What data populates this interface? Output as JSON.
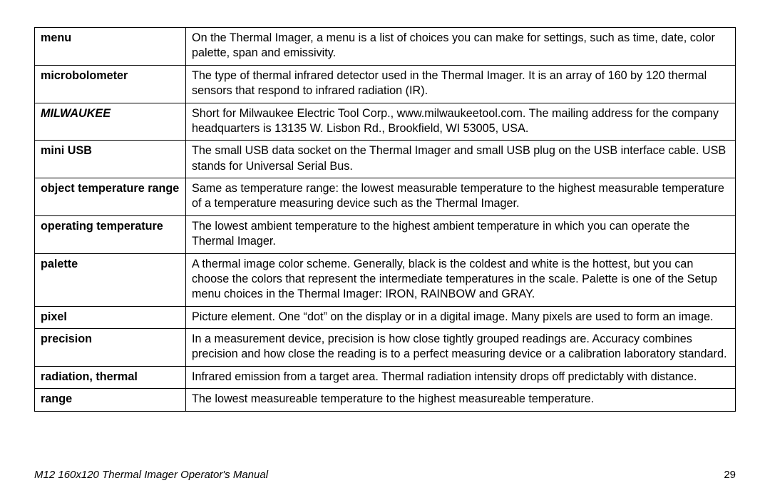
{
  "glossary": [
    {
      "term": "menu",
      "termClass": "",
      "def": "On the Thermal Imager, a menu is a list of choices you can make for settings, such as time, date, color palette, span and emissivity."
    },
    {
      "term": "microbolometer",
      "termClass": "",
      "def": "The type of thermal infrared detector used in the Thermal Imager. It is an array of 160 by 120 thermal sensors that respond to infrared radiation (IR)."
    },
    {
      "term": "MILWAUKEE",
      "termClass": "italic",
      "def": "Short for Milwaukee Electric Tool Corp., www.milwaukeetool.com. The mailing address for the company headquarters is 13135 W. Lisbon Rd., Brookfield, WI 53005, USA."
    },
    {
      "term": "mini USB",
      "termClass": "",
      "def": "The small USB data socket on the Thermal Imager and small USB plug on the USB interface cable. USB stands for Universal Serial Bus."
    },
    {
      "term": "object temperature range",
      "termClass": "",
      "def": "Same as temperature range: the lowest measurable temperature to the highest measurable temperature of a temperature measuring device such as the Thermal Imager."
    },
    {
      "term": "operating temperature",
      "termClass": "",
      "def": "The lowest ambient temperature to the highest ambient temperature in which you can operate the Thermal Imager."
    },
    {
      "term": "palette",
      "termClass": "",
      "def": "A thermal image color scheme. Generally, black is the coldest and white is the hottest, but you can choose the colors that represent the intermediate temperatures in the scale. Palette is one of the Setup menu choices in the Thermal Imager: IRON, RAINBOW and GRAY."
    },
    {
      "term": "pixel",
      "termClass": "",
      "def": "Picture element. One “dot” on the display or in a digital image. Many pixels are used to form an image."
    },
    {
      "term": "precision",
      "termClass": "",
      "def": "In a measurement device, precision is how close tightly grouped readings are. Accuracy combines precision and how close the reading is to a perfect measuring device or a calibration laboratory standard."
    },
    {
      "term": "radiation, thermal",
      "termClass": "",
      "def": "Infrared emission from a target area. Thermal radiation intensity drops off predictably with distance."
    },
    {
      "term": "range",
      "termClass": "",
      "def": "The lowest measureable temperature to the highest measureable temperature."
    }
  ],
  "footer": {
    "title": "M12 160x120 Thermal Imager Operator's Manual",
    "page": "29"
  }
}
